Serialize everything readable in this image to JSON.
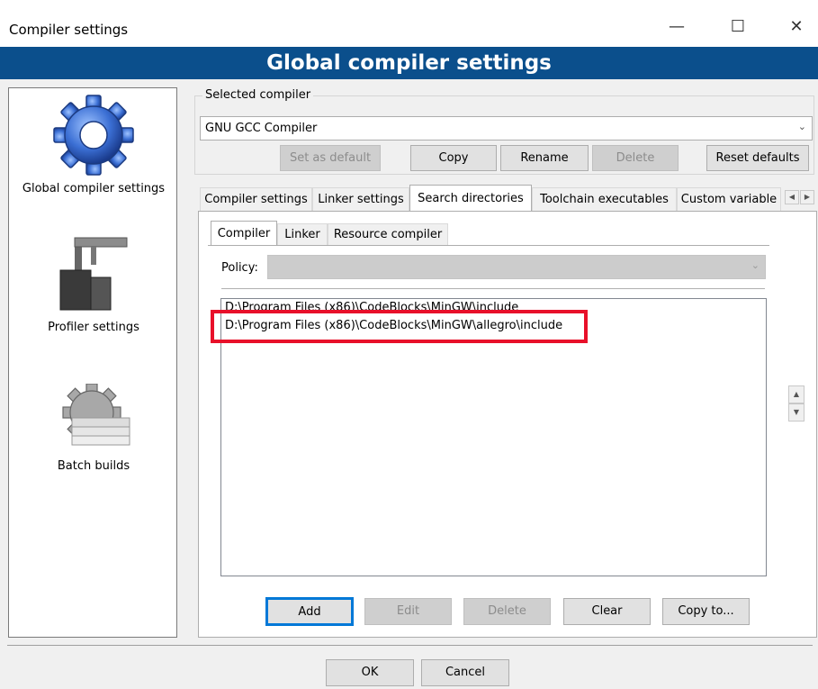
{
  "window": {
    "title": "Compiler settings",
    "minimize_glyph": "—",
    "maximize_glyph": "☐",
    "close_glyph": "✕"
  },
  "banner": {
    "title": "Global compiler settings"
  },
  "sidebar": {
    "items": [
      {
        "label": "Global compiler settings",
        "icon": "gear-icon"
      },
      {
        "label": "Profiler settings",
        "icon": "caliper-icon"
      },
      {
        "label": "Batch builds",
        "icon": "batch-gear-icon"
      }
    ]
  },
  "compiler_group": {
    "legend": "Selected compiler",
    "selected": "GNU GCC Compiler",
    "buttons": {
      "set_default": "Set as default",
      "copy": "Copy",
      "rename": "Rename",
      "delete": "Delete",
      "reset": "Reset defaults"
    }
  },
  "tabs": [
    "Compiler settings",
    "Linker settings",
    "Search directories",
    "Toolchain executables",
    "Custom variable"
  ],
  "subtabs": [
    "Compiler",
    "Linker",
    "Resource compiler"
  ],
  "policy": {
    "label": "Policy:",
    "value": ""
  },
  "directories": [
    "D:\\Program Files (x86)\\CodeBlocks\\MinGW\\include",
    "D:\\Program Files (x86)\\CodeBlocks\\MinGW\\allegro\\include"
  ],
  "dir_buttons": {
    "add": "Add",
    "edit": "Edit",
    "delete": "Delete",
    "clear": "Clear",
    "copy_to": "Copy to..."
  },
  "dialog_buttons": {
    "ok": "OK",
    "cancel": "Cancel"
  },
  "colors": {
    "banner": "#0b4f8c",
    "highlight": "#e8102a",
    "focus": "#0078d7"
  }
}
